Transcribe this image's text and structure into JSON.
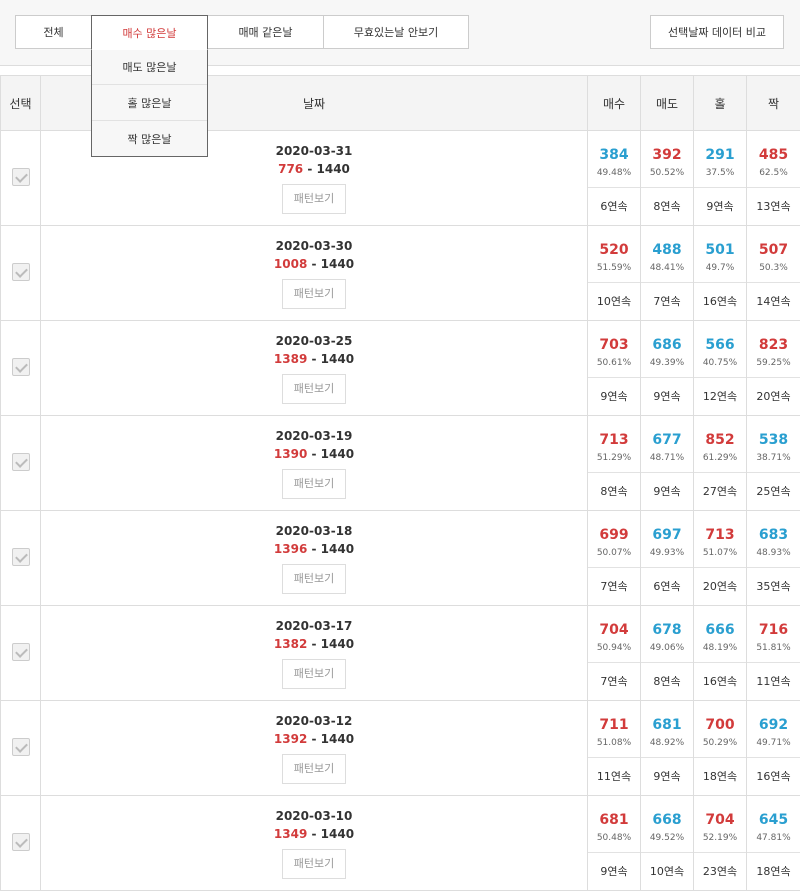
{
  "toolbar": {
    "tabs": [
      {
        "label": "전체",
        "active": false
      },
      {
        "label": "매수 많은날",
        "active": true
      },
      {
        "label": "매매 같은날",
        "active": false
      },
      {
        "label": "무효있는날 안보기",
        "active": false
      }
    ],
    "dropdown": [
      "매도 많은날",
      "홀 많은날",
      "짝 많은날"
    ],
    "compare_label": "선택날짜 데이터 비교"
  },
  "table": {
    "headers": {
      "select": "선택",
      "date": "날짜",
      "buy": "매수",
      "sell": "매도",
      "odd": "홀",
      "even": "짝"
    },
    "pattern_label": "패턴보기",
    "colors": {
      "red": "#d23b3b",
      "blue": "#2a9fd0"
    },
    "rows": [
      {
        "date": "2020-03-31",
        "done": "776",
        "total": "1440",
        "stats": [
          {
            "num": "384",
            "pct": "49.48%",
            "streak": "6연속",
            "color": "blue"
          },
          {
            "num": "392",
            "pct": "50.52%",
            "streak": "8연속",
            "color": "red"
          },
          {
            "num": "291",
            "pct": "37.5%",
            "streak": "9연속",
            "color": "blue"
          },
          {
            "num": "485",
            "pct": "62.5%",
            "streak": "13연속",
            "color": "red"
          }
        ]
      },
      {
        "date": "2020-03-30",
        "done": "1008",
        "total": "1440",
        "stats": [
          {
            "num": "520",
            "pct": "51.59%",
            "streak": "10연속",
            "color": "red"
          },
          {
            "num": "488",
            "pct": "48.41%",
            "streak": "7연속",
            "color": "blue"
          },
          {
            "num": "501",
            "pct": "49.7%",
            "streak": "16연속",
            "color": "blue"
          },
          {
            "num": "507",
            "pct": "50.3%",
            "streak": "14연속",
            "color": "red"
          }
        ]
      },
      {
        "date": "2020-03-25",
        "done": "1389",
        "total": "1440",
        "stats": [
          {
            "num": "703",
            "pct": "50.61%",
            "streak": "9연속",
            "color": "red"
          },
          {
            "num": "686",
            "pct": "49.39%",
            "streak": "9연속",
            "color": "blue"
          },
          {
            "num": "566",
            "pct": "40.75%",
            "streak": "12연속",
            "color": "blue"
          },
          {
            "num": "823",
            "pct": "59.25%",
            "streak": "20연속",
            "color": "red"
          }
        ]
      },
      {
        "date": "2020-03-19",
        "done": "1390",
        "total": "1440",
        "stats": [
          {
            "num": "713",
            "pct": "51.29%",
            "streak": "8연속",
            "color": "red"
          },
          {
            "num": "677",
            "pct": "48.71%",
            "streak": "9연속",
            "color": "blue"
          },
          {
            "num": "852",
            "pct": "61.29%",
            "streak": "27연속",
            "color": "red"
          },
          {
            "num": "538",
            "pct": "38.71%",
            "streak": "25연속",
            "color": "blue"
          }
        ]
      },
      {
        "date": "2020-03-18",
        "done": "1396",
        "total": "1440",
        "stats": [
          {
            "num": "699",
            "pct": "50.07%",
            "streak": "7연속",
            "color": "red"
          },
          {
            "num": "697",
            "pct": "49.93%",
            "streak": "6연속",
            "color": "blue"
          },
          {
            "num": "713",
            "pct": "51.07%",
            "streak": "20연속",
            "color": "red"
          },
          {
            "num": "683",
            "pct": "48.93%",
            "streak": "35연속",
            "color": "blue"
          }
        ]
      },
      {
        "date": "2020-03-17",
        "done": "1382",
        "total": "1440",
        "stats": [
          {
            "num": "704",
            "pct": "50.94%",
            "streak": "7연속",
            "color": "red"
          },
          {
            "num": "678",
            "pct": "49.06%",
            "streak": "8연속",
            "color": "blue"
          },
          {
            "num": "666",
            "pct": "48.19%",
            "streak": "16연속",
            "color": "blue"
          },
          {
            "num": "716",
            "pct": "51.81%",
            "streak": "11연속",
            "color": "red"
          }
        ]
      },
      {
        "date": "2020-03-12",
        "done": "1392",
        "total": "1440",
        "stats": [
          {
            "num": "711",
            "pct": "51.08%",
            "streak": "11연속",
            "color": "red"
          },
          {
            "num": "681",
            "pct": "48.92%",
            "streak": "9연속",
            "color": "blue"
          },
          {
            "num": "700",
            "pct": "50.29%",
            "streak": "18연속",
            "color": "red"
          },
          {
            "num": "692",
            "pct": "49.71%",
            "streak": "16연속",
            "color": "blue"
          }
        ]
      },
      {
        "date": "2020-03-10",
        "done": "1349",
        "total": "1440",
        "stats": [
          {
            "num": "681",
            "pct": "50.48%",
            "streak": "9연속",
            "color": "red"
          },
          {
            "num": "668",
            "pct": "49.52%",
            "streak": "10연속",
            "color": "blue"
          },
          {
            "num": "704",
            "pct": "52.19%",
            "streak": "23연속",
            "color": "red"
          },
          {
            "num": "645",
            "pct": "47.81%",
            "streak": "18연속",
            "color": "blue"
          }
        ]
      }
    ]
  }
}
